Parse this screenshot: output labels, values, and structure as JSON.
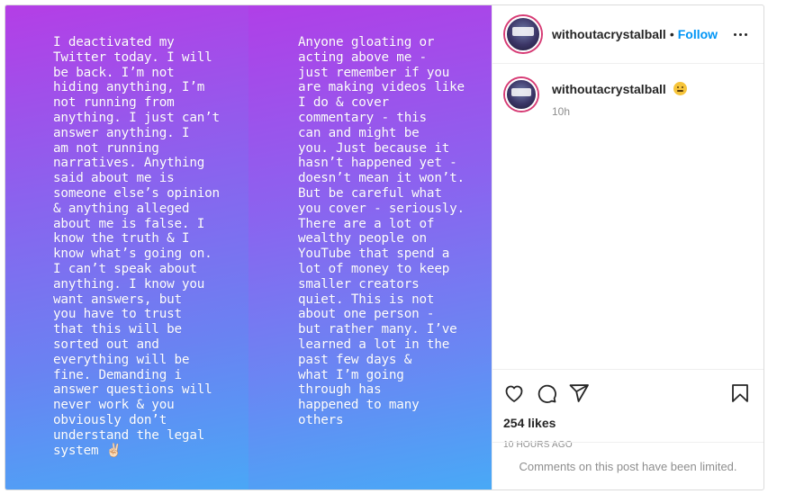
{
  "story_left": {
    "text": "I deactivated my\nTwitter today. I will\nbe back. I’m not\nhiding anything, I’m\nnot running from\nanything. I just can’t\nanswer anything. I\nam not running\nnarratives. Anything\nsaid about me is\nsomeone else’s opinion\n& anything alleged\nabout me is false. I\nknow the truth & I\nknow what’s going on.\nI can’t speak about\nanything. I know you\nwant answers, but\nyou have to trust\nthat this will be\nsorted out and\neverything will be\nfine. Demanding i\nanswer questions will\nnever work & you\nobviously don’t\nunderstand the legal\nsystem ✌🏻"
  },
  "story_right": {
    "text": "Anyone gloating or\nacting above me -\njust remember if you\nare making videos like\nI do & cover\ncommentary - this\ncan and might be\nyou. Just because it\nhasn’t happened yet -\ndoesn’t mean it won’t.\nBut be careful what\nyou cover - seriously.\nThere are a lot of\nwealthy people on\nYouTube that spend a\nlot of money to keep\nsmaller creators\nquiet. This is not\nabout one person -\nbut rather many. I’ve\nlearned a lot in the\npast few days &\nwhat I’m going\nthrough has\nhappened to many\nothers"
  },
  "header": {
    "username": "withoutacrystalball",
    "separator": "•",
    "follow_label": "Follow"
  },
  "caption": {
    "username": "withoutacrystalball",
    "emoji": "zipper-mouth-face",
    "time": "10h"
  },
  "actions": {
    "icons": [
      "heart-icon",
      "comment-icon",
      "share-icon",
      "bookmark-icon"
    ]
  },
  "likes": "254 likes",
  "date": "10 HOURS AGO",
  "comments_limited": "Comments on this post have been limited.",
  "colors": {
    "gradient_top": "#b43ee6",
    "gradient_bottom": "#4aa7f6",
    "follow_blue": "#0095f6",
    "text_dark": "#262626",
    "text_gray": "#8e8e8e"
  }
}
